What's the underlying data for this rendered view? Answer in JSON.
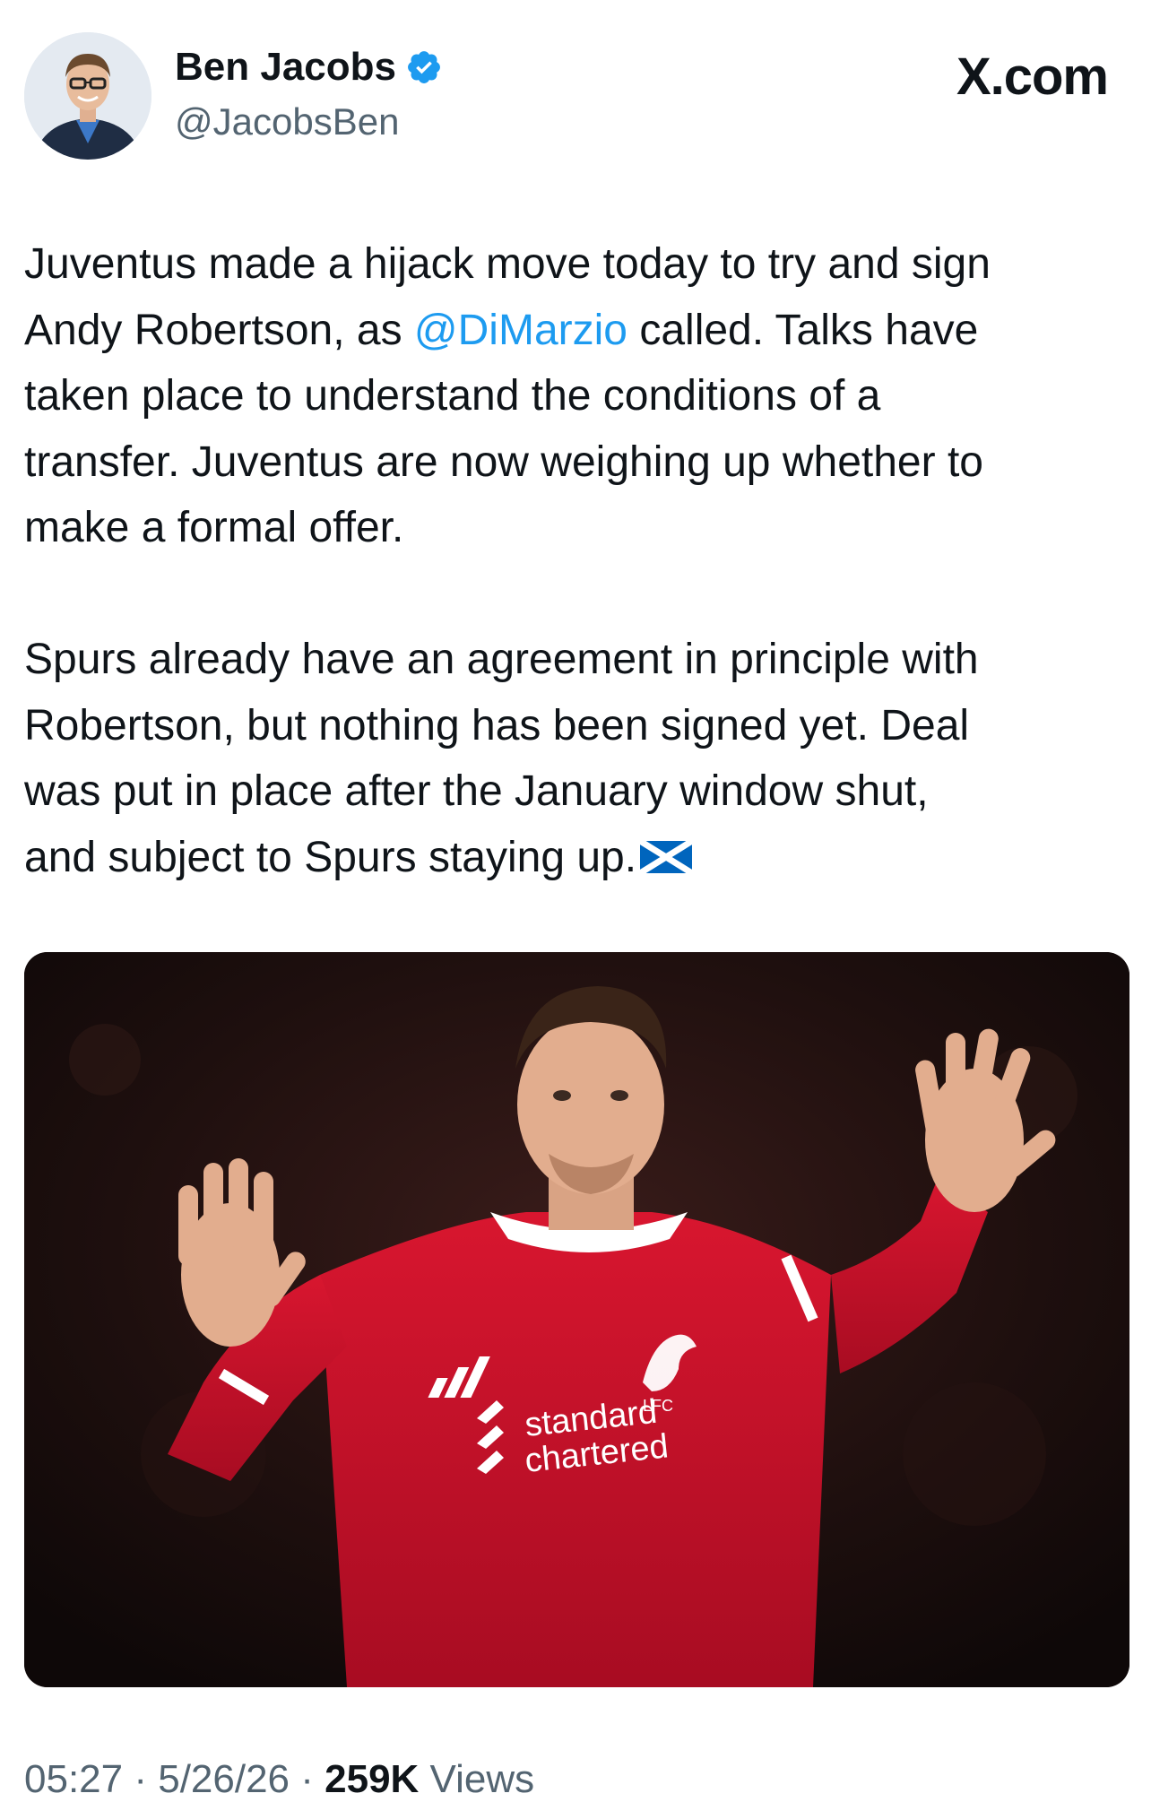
{
  "author": {
    "name": "Ben Jacobs",
    "handle": "@JacobsBen",
    "verified_color": "#1d9bf0"
  },
  "brand": "X.com",
  "tweet": {
    "lines_p1": [
      "Juventus made a hijack move today to try and sign",
      "called. Talks have",
      "taken place to understand the conditions of a",
      "transfer. Juventus are now weighing up whether to",
      "make a formal offer."
    ],
    "line2_prefix": "Andy Robertson, as ",
    "mention": "@DiMarzio",
    "lines_p2": [
      "Spurs already have an agreement in principle with",
      "Robertson, but nothing has been signed yet. Deal",
      "was put in place after the January window shut,",
      "and subject to Spurs staying up."
    ],
    "flag_emoji": "scotland-flag"
  },
  "media": {
    "sponsor_line1": "standard",
    "sponsor_line2": "chartered",
    "crest_text": "LFC"
  },
  "meta": {
    "time": "05:27",
    "sep1": " · ",
    "date": "5/26/26",
    "sep2": " · ",
    "views_count": "259K",
    "views_label": " Views"
  },
  "colors": {
    "text": "#0f1419",
    "secondary": "#536471",
    "link": "#1d9bf0",
    "shirt": "#c8102e"
  }
}
